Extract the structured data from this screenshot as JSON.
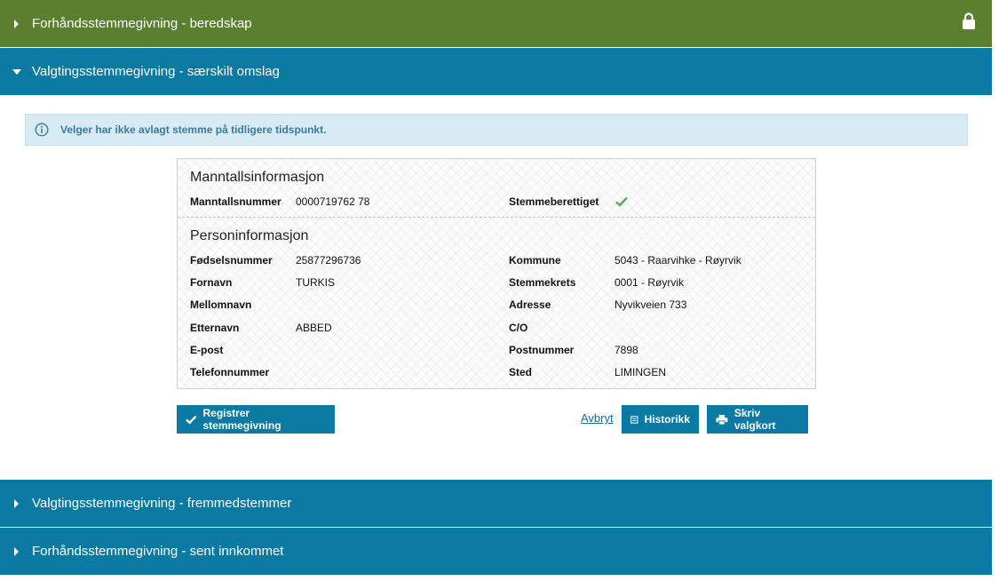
{
  "accordion": {
    "section1": {
      "title": "Forhåndsstemmegivning - beredskap"
    },
    "section2": {
      "title": "Valgtingsstemmegivning - særskilt omslag"
    },
    "section3": {
      "title": "Valgtingsstemmegivning - fremmedstemmer"
    },
    "section4": {
      "title": "Forhåndsstemmegivning - sent innkommet"
    }
  },
  "info": {
    "message": "Velger har ikke avlagt stemme på tidligere tidspunkt."
  },
  "manntall": {
    "heading": "Manntallsinformasjon",
    "number_label": "Manntallsnummer",
    "number_value": "0000719762 78",
    "eligible_label": "Stemmeberettiget"
  },
  "person": {
    "heading": "Personinformasjon",
    "left": [
      {
        "label": "Fødselsnummer",
        "value": "25877296736"
      },
      {
        "label": "Fornavn",
        "value": "TURKIS"
      },
      {
        "label": "Mellomnavn",
        "value": ""
      },
      {
        "label": "Etternavn",
        "value": "ABBED"
      },
      {
        "label": "E-post",
        "value": ""
      },
      {
        "label": "Telefonnummer",
        "value": ""
      }
    ],
    "right": [
      {
        "label": "Kommune",
        "value": "5043 - Raarvihke - Røyrvik"
      },
      {
        "label": "Stemmekrets",
        "value": "0001 - Røyrvik"
      },
      {
        "label": "Adresse",
        "value": "Nyvikveien 733"
      },
      {
        "label": "C/O",
        "value": ""
      },
      {
        "label": "Postnummer",
        "value": "7898"
      },
      {
        "label": "Sted",
        "value": "LIMINGEN"
      }
    ]
  },
  "actions": {
    "register": "Registrer stemmegivning",
    "cancel": "Avbryt",
    "history": "Historikk",
    "print": "Skriv valgkort"
  },
  "colors": {
    "green_header": "#5a7f2f",
    "blue_header": "#0b7aa3",
    "check": "#4caf50"
  },
  "icons": [
    "lock-icon",
    "info-icon",
    "check-icon",
    "list-icon",
    "printer-icon",
    "caret-right-icon",
    "caret-down-icon"
  ]
}
